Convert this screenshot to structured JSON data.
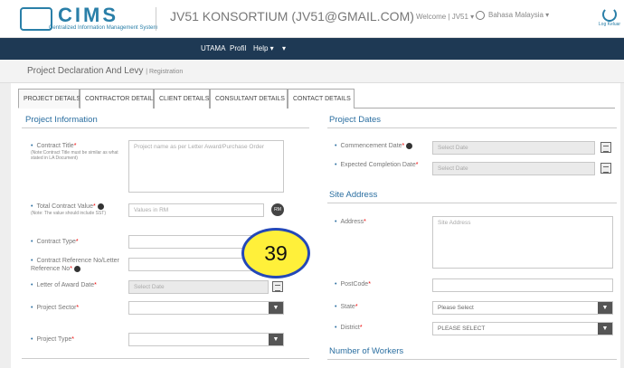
{
  "header": {
    "logo_text": "CIMS",
    "logo_sub": "Centralized Information Management System",
    "company": "JV51 KONSORTIUM (JV51@GMAIL.COM)",
    "welcome": "Welcome | JV51 ▾",
    "language": "Bahasa Malaysia ▾",
    "logout": "Log Keluar"
  },
  "nav": {
    "items": [
      "UTAMA",
      "Profil",
      "Help ▾",
      "▾"
    ]
  },
  "breadcrumb": {
    "title": "Project Declaration And Levy",
    "sub": "| Registration"
  },
  "tabs": [
    "PROJECT DETAILS",
    "CONTRACTOR DETAILS",
    "CLIENT DETAILS",
    "CONSULTANT DETAILS",
    "CONTACT DETAILS"
  ],
  "left": {
    "section": "Project Information",
    "contract_title_label": "Contract Title",
    "contract_title_note": "(Note:Contract Title must be similar as what stated in LA Document)",
    "contract_title_placeholder": "Project name as per Letter Award/Purchase Order",
    "total_value_label": "Total Contract Value",
    "total_value_note": "(Note: The value should include SST)",
    "total_value_placeholder": "Values in RM",
    "rm_label": "RM",
    "contract_type_label": "Contract Type",
    "contract_ref_label": "Contract Reference No/Letter Reference No",
    "award_date_label": "Letter of Award Date",
    "award_date_placeholder": "Select Date",
    "sector_label": "Project Sector",
    "type_label": "Project Type"
  },
  "right": {
    "dates_section": "Project Dates",
    "commencement_label": "Commencement Date",
    "commencement_placeholder": "Select Date",
    "completion_label": "Expected Completion Date",
    "completion_placeholder": "Select Date",
    "site_section": "Site Address",
    "address_label": "Address",
    "address_placeholder": "Site Address",
    "postcode_label": "PostCode",
    "state_label": "State",
    "state_value": "Please Select",
    "district_label": "District",
    "district_value": "PLEASE SELECT",
    "workers_section": "Number of Workers"
  },
  "req_mark": "*",
  "badge": "39"
}
